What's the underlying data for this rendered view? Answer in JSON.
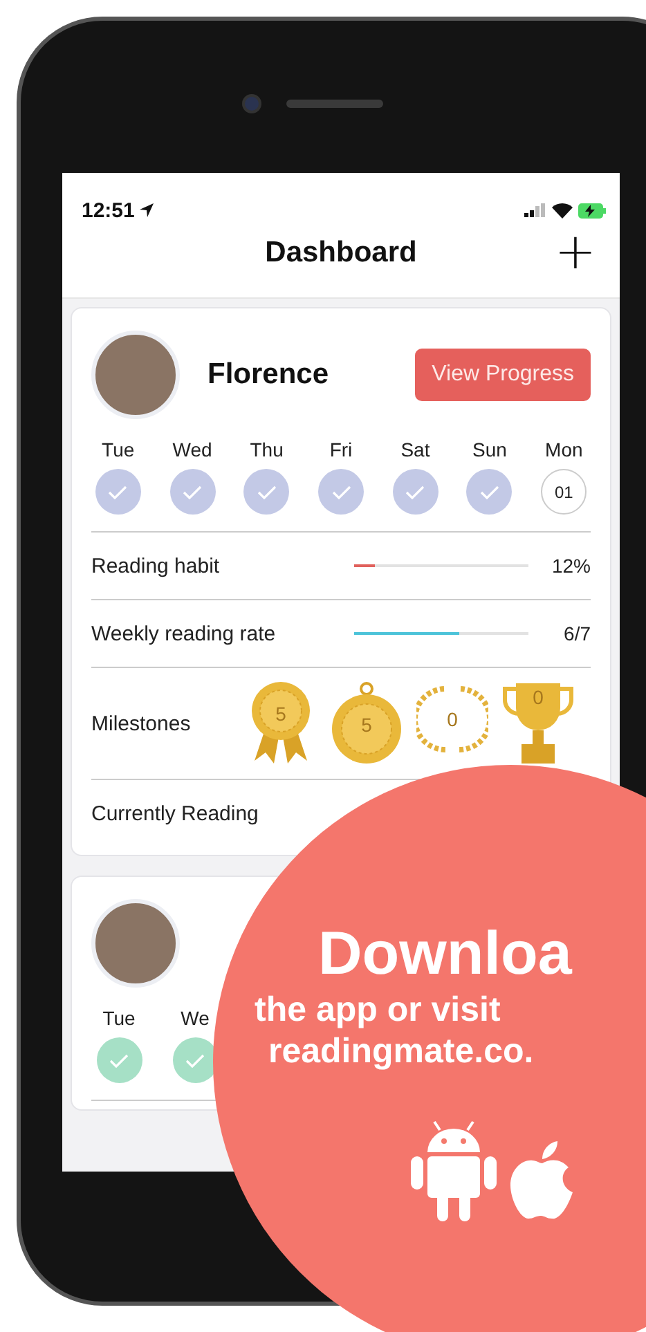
{
  "status_bar": {
    "time": "12:51"
  },
  "header": {
    "title": "Dashboard",
    "add_symbol": "+"
  },
  "readers": [
    {
      "name": "Florence",
      "button": "View Progress",
      "color": "#c3c9e6",
      "days": [
        {
          "label": "Tue",
          "done": true
        },
        {
          "label": "Wed",
          "done": true
        },
        {
          "label": "Thu",
          "done": true
        },
        {
          "label": "Fri",
          "done": true
        },
        {
          "label": "Sat",
          "done": true
        },
        {
          "label": "Sun",
          "done": true
        },
        {
          "label": "Mon",
          "done": false,
          "date": "01"
        }
      ],
      "stats": [
        {
          "label": "Reading habit",
          "level": 0.12,
          "reading": "12%",
          "color": "#e0615c"
        },
        {
          "label": "Weekly reading rate",
          "level": 0.6,
          "reading": "6/7",
          "color": "#4cc3d9"
        }
      ],
      "milestones": {
        "label": "Milestones",
        "badges": [
          {
            "kind": "rosette",
            "count": "5"
          },
          {
            "kind": "medal",
            "count": "5"
          },
          {
            "kind": "wreath",
            "count": "0"
          },
          {
            "kind": "trophy",
            "count": "0"
          }
        ]
      },
      "current": {
        "label": "Currently Reading"
      }
    },
    {
      "color": "#a6e0c6",
      "days": [
        {
          "label": "Tue",
          "done": true
        },
        {
          "label": "We",
          "done": true
        }
      ]
    }
  ],
  "promo": {
    "headline": "Downloa",
    "line_1": "the app or visit",
    "line_2": "readingmate.co."
  }
}
